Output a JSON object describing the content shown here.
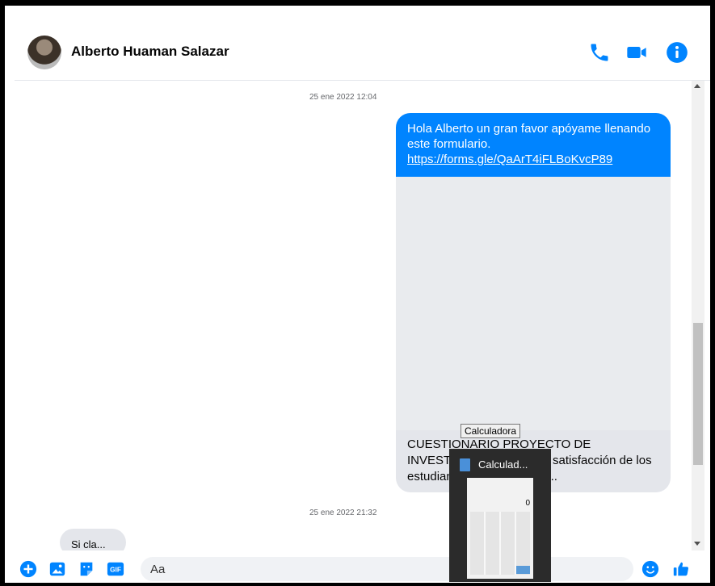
{
  "header": {
    "contact_name": "Alberto Huaman Salazar",
    "icons": [
      "phone-icon",
      "video-icon",
      "info-icon"
    ]
  },
  "chat": {
    "timestamp_1": "25 ene 2022 12:04",
    "outgoing_message": "Hola  Alberto un gran favor apóyame llenando este formulario.",
    "outgoing_link": "https://forms.gle/QaArT4iFLBoKvcP89",
    "link_preview_text": "CUESTIONARIO PROYECTO DE INVESTIGACIÓN Nivel de satisfacción de los estudiantes de la escuela ...",
    "timestamp_2": "25 ene 2022 21:32",
    "incoming_partial": "Si cla..."
  },
  "composer": {
    "placeholder": "Aa",
    "icons": [
      "plus-icon",
      "photo-icon",
      "sticker-icon",
      "gif-icon",
      "emoji-icon",
      "like-icon"
    ]
  },
  "taskbar_preview": {
    "tooltip": "Calculadora",
    "title": "Calculad...",
    "display_value": "0"
  },
  "colors": {
    "accent": "#0084ff",
    "bubble_gray": "#e4e6eb"
  }
}
